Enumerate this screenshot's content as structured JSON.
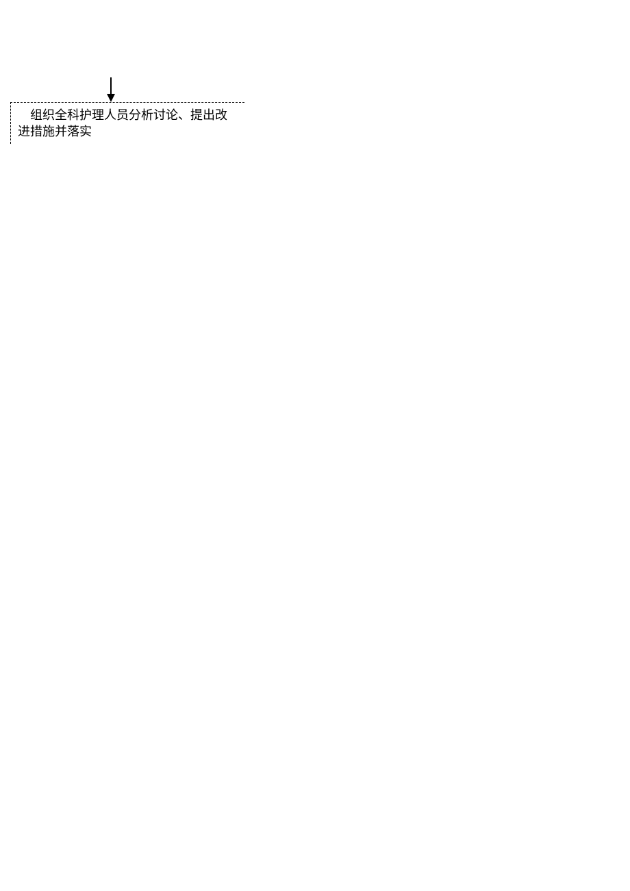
{
  "diagram": {
    "arrow": {
      "direction": "down"
    },
    "box": {
      "line1": "组织全科护理人员分析讨论、提出改",
      "line2": "进措施并落实"
    }
  }
}
